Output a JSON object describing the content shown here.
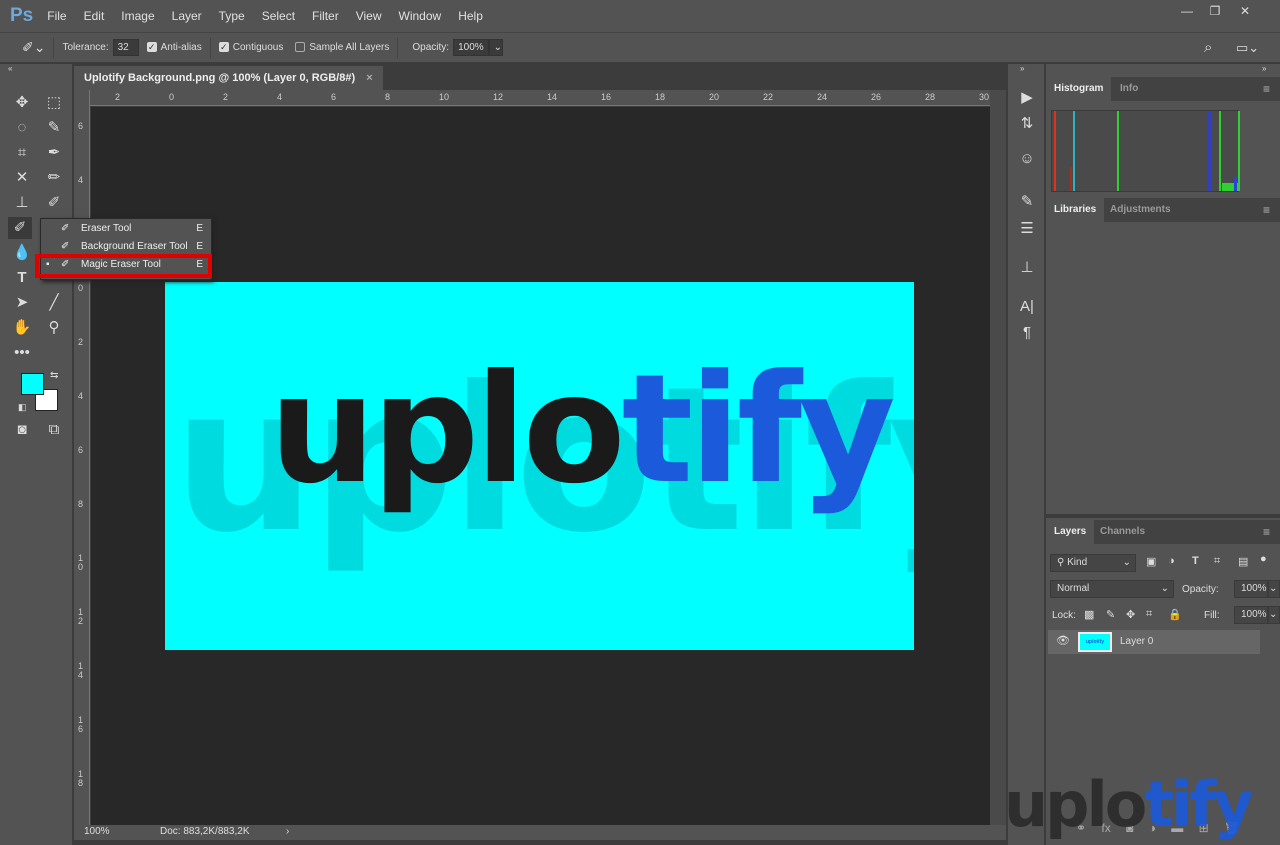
{
  "app": {
    "logo": "Ps",
    "menu": [
      "File",
      "Edit",
      "Image",
      "Layer",
      "Type",
      "Select",
      "Filter",
      "View",
      "Window",
      "Help"
    ],
    "window_controls": [
      "minimize",
      "restore",
      "close"
    ]
  },
  "options": {
    "tolerance_label": "Tolerance:",
    "tolerance": "32",
    "anti_alias": "Anti-alias",
    "anti_alias_checked": true,
    "contiguous": "Contiguous",
    "contiguous_checked": true,
    "sample_all": "Sample All Layers",
    "sample_all_checked": false,
    "opacity_label": "Opacity:",
    "opacity": "100%"
  },
  "document": {
    "tab_title": "Uplotify Background.png @ 100% (Layer 0, RGB/8#)",
    "close": "×",
    "zoom": "100%",
    "doc_info": "Doc: 883,2K/883,2K",
    "canvas_color": "#00ffff"
  },
  "rulers": {
    "top": [
      "2",
      "0",
      "2",
      "4",
      "6",
      "8",
      "10",
      "12",
      "14",
      "16",
      "18",
      "20",
      "22",
      "24",
      "26",
      "28",
      "30"
    ],
    "left": [
      "6",
      "4",
      "2",
      "0",
      "2",
      "4",
      "6",
      "8",
      "10",
      "12",
      "14",
      "16",
      "18"
    ]
  },
  "image_text": {
    "dark": "uplo",
    "blue": "tify",
    "shadow": "uplotify",
    "dark_color": "#1a1a1a",
    "blue_color": "#1a5adb"
  },
  "flyout": {
    "items": [
      {
        "label": "Eraser Tool",
        "key": "E"
      },
      {
        "label": "Background Eraser Tool",
        "key": "E"
      },
      {
        "label": "Magic Eraser Tool",
        "key": "E",
        "selected": true
      }
    ]
  },
  "colors": {
    "foreground": "#00ffff",
    "background": "#ffffff",
    "highlight": "#e00000"
  },
  "panels": {
    "top_tabs": [
      "Histogram",
      "Info"
    ],
    "mid_tabs": [
      "Libraries",
      "Adjustments"
    ],
    "layers_tabs": [
      "Layers",
      "Channels"
    ],
    "filter_kind": "Kind",
    "blend_mode": "Normal",
    "opacity_label": "Opacity:",
    "opacity": "100%",
    "lock_label": "Lock:",
    "fill_label": "Fill:",
    "fill": "100%",
    "layers": [
      {
        "name": "Layer 0",
        "visible": true,
        "thumb_text": "uplotify"
      }
    ]
  },
  "watermark": {
    "dark": "uplo",
    "blue": "tify"
  }
}
